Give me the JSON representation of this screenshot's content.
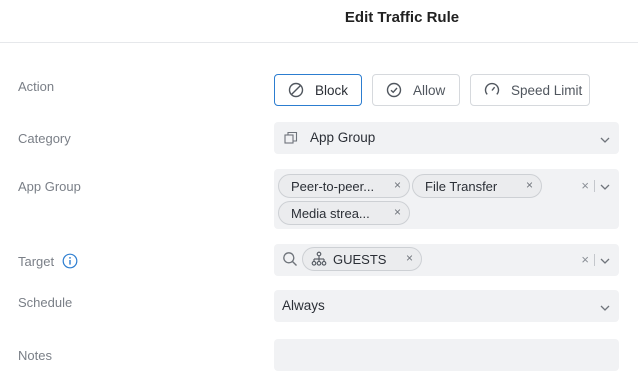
{
  "header": {
    "title": "Edit Traffic Rule"
  },
  "labels": {
    "action": "Action",
    "category": "Category",
    "app_group": "App Group",
    "target": "Target",
    "schedule": "Schedule",
    "notes": "Notes"
  },
  "action": {
    "options": [
      "Block",
      "Allow",
      "Speed Limit"
    ],
    "selected": "Block"
  },
  "category": {
    "value": "App Group"
  },
  "app_group": {
    "chips": [
      "Peer-to-peer...",
      "File Transfer",
      "Media strea..."
    ]
  },
  "target": {
    "chip": "GUESTS"
  },
  "schedule": {
    "value": "Always"
  },
  "notes": {
    "value": ""
  },
  "glyphs": {
    "remove": "×"
  },
  "colors": {
    "accent": "#2c7dd0",
    "field_bg": "#f1f2f4",
    "label": "#7a7f87"
  }
}
